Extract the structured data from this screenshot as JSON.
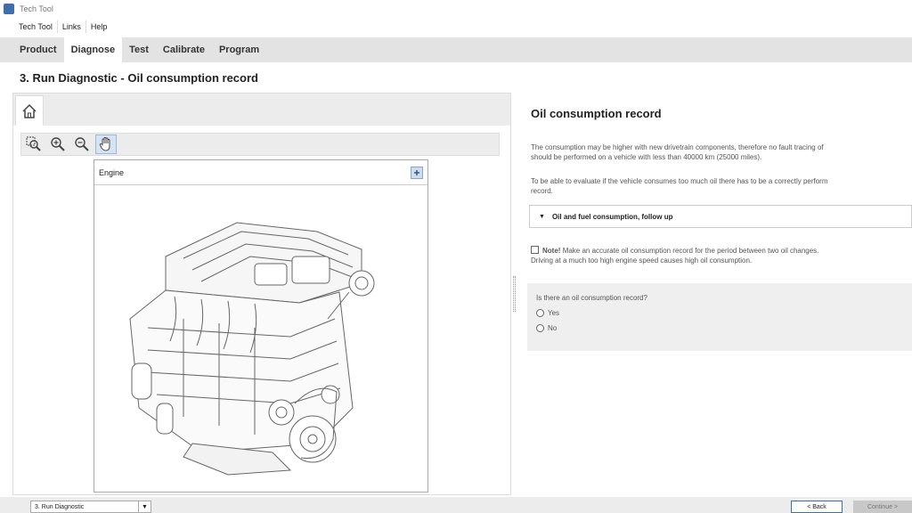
{
  "window": {
    "title": "Tech Tool",
    "accent_color": "#3f6fa8"
  },
  "menubar": {
    "items": [
      "Tech Tool",
      "Links",
      "Help"
    ]
  },
  "tabs": [
    {
      "label": "Product",
      "active": false
    },
    {
      "label": "Diagnose",
      "active": true
    },
    {
      "label": "Test",
      "active": false
    },
    {
      "label": "Calibrate",
      "active": false
    },
    {
      "label": "Program",
      "active": false
    }
  ],
  "page": {
    "title": "3. Run Diagnostic - Oil consumption record"
  },
  "left": {
    "home_icon": "home-icon",
    "tools": [
      "zoom-area-icon",
      "zoom-in-icon",
      "zoom-out-icon",
      "pan-hand-icon"
    ],
    "engine_panel": {
      "title": "Engine",
      "expand_icon": "plus-icon"
    }
  },
  "right": {
    "title": "Oil consumption record",
    "para1_line1": "The consumption may be higher with new drivetrain components, therefore no fault tracing of",
    "para1_line2": "should be performed on a vehicle with less than 40000 km (25000 miles).",
    "para2_line1": "To be able to evaluate if the vehicle consumes too much oil there has to be a correctly perform",
    "para2_line2": "record.",
    "dropdown_label": "Oil and fuel consumption, follow up",
    "note_label": "Note!",
    "note_line1": "Make an accurate oil consumption record for the period between two oil changes.",
    "note_line2": "Driving at a much too high engine speed causes high oil consumption.",
    "question": "Is there an oil consumption record?",
    "options": [
      "Yes",
      "No"
    ]
  },
  "bottom": {
    "step_select": "3. Run Diagnostic",
    "back_label": "< Back",
    "continue_label": "Continue >"
  }
}
